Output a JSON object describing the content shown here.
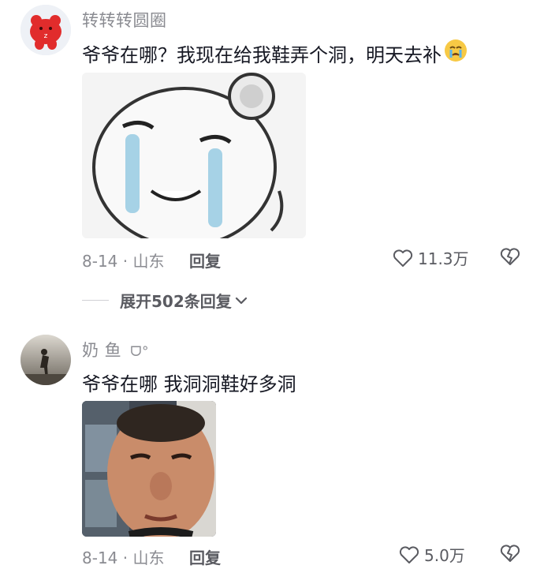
{
  "comments": [
    {
      "username": "转转转圆圈",
      "text": "爷爷在哪？我现在给我鞋弄个洞，明天去补",
      "emoji": "crying-face",
      "image": "crying-bear-meme",
      "date_location": "8-14 · 山东",
      "reply_label": "回复",
      "likes": "11.3万"
    },
    {
      "username": "奶 鱼",
      "username_suffix": "ᗜ°",
      "text": "爷爷在哪 我洞洞鞋好多洞",
      "image": "crying-man-photo",
      "date_location": "8-14 · 山东",
      "reply_label": "回复",
      "likes": "5.0万"
    }
  ],
  "expand_replies": "展开502条回复",
  "icons": {
    "like": "heart-outline-icon",
    "dislike": "broken-heart-icon",
    "expand": "chevron-down-icon"
  }
}
